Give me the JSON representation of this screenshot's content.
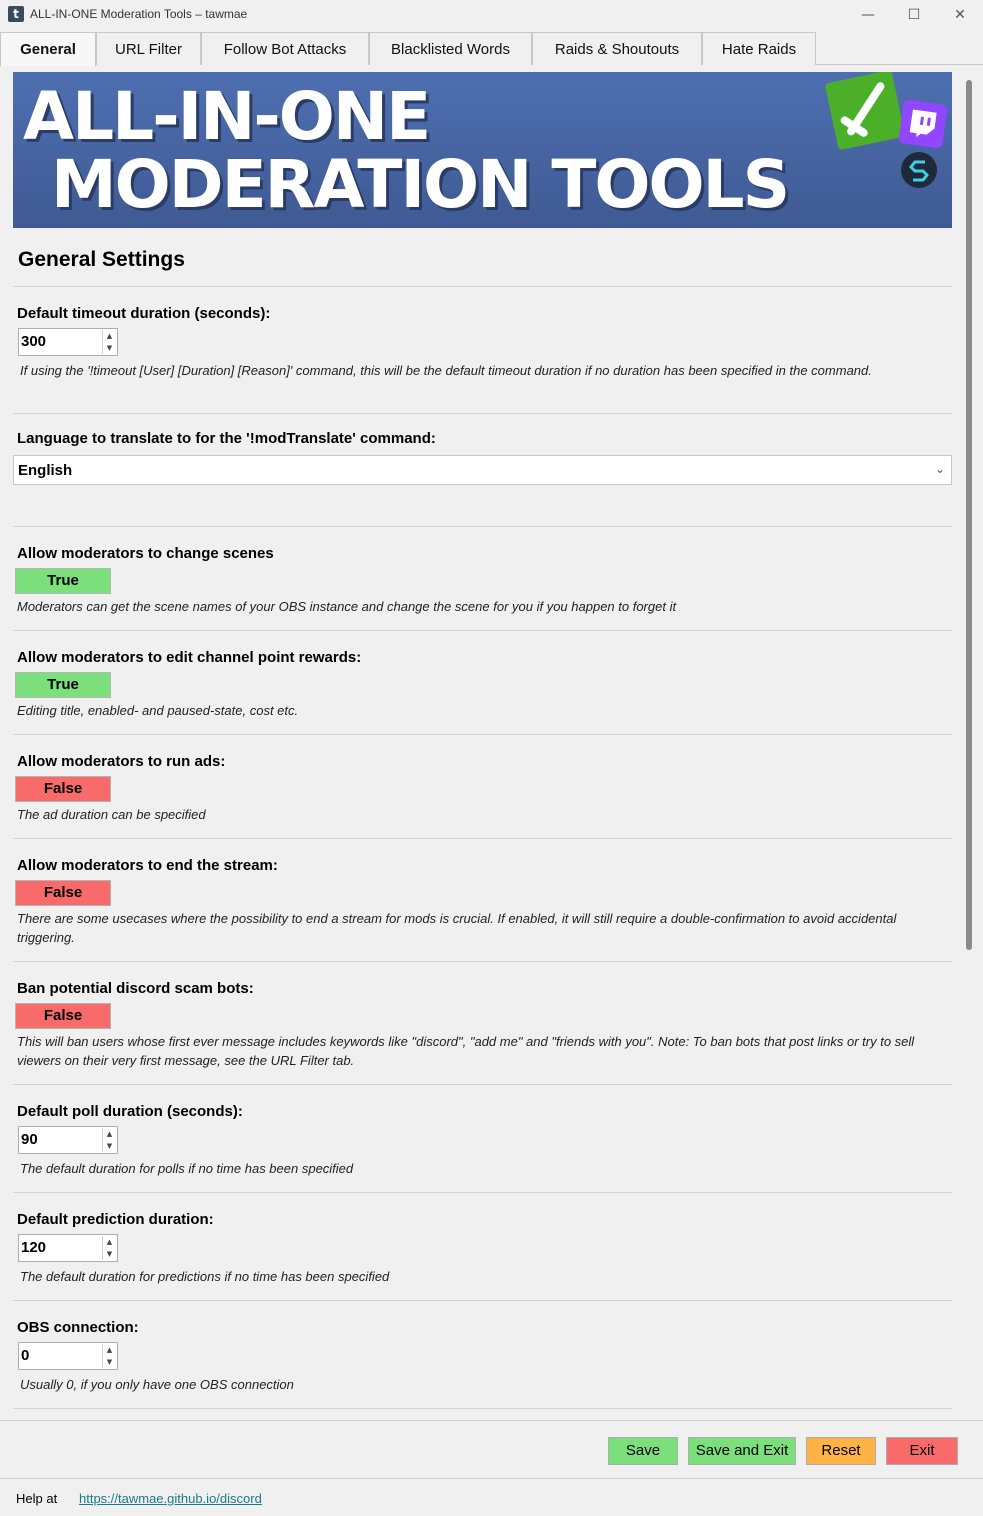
{
  "window": {
    "title": "ALL-IN-ONE Moderation Tools – tawmae",
    "app_icon_letter": "t",
    "minimize": "—",
    "maximize": "☐",
    "close": "✕"
  },
  "tabs": [
    {
      "label": "General",
      "active": true
    },
    {
      "label": "URL Filter"
    },
    {
      "label": "Follow Bot Attacks"
    },
    {
      "label": "Blacklisted Words"
    },
    {
      "label": "Raids & Shoutouts"
    },
    {
      "label": "Hate Raids"
    }
  ],
  "banner": {
    "line1": "ALL-IN-ONE",
    "line2": "MODERATION TOOLS"
  },
  "general": {
    "section_title": "General Settings",
    "timeout": {
      "label": "Default timeout duration (seconds):",
      "value": "300",
      "desc": "If using the '!timeout [User] [Duration] [Reason]' command, this will be the default timeout duration if no duration has been specified in the command."
    },
    "translate": {
      "label": "Language to translate to for the '!modTranslate' command:",
      "value": "English"
    },
    "scenes": {
      "label": "Allow moderators to change scenes",
      "value": "True",
      "desc": "Moderators can get the scene names of your OBS instance and change the scene for you if you happen to forget it"
    },
    "rewards": {
      "label": "Allow moderators to edit channel point rewards:",
      "value": "True",
      "desc": "Editing title, enabled- and paused-state, cost etc."
    },
    "ads": {
      "label": "Allow moderators to run ads:",
      "value": "False",
      "desc": "The ad duration can be specified"
    },
    "endstream": {
      "label": "Allow moderators to end the stream:",
      "value": "False",
      "desc": "There are some usecases where the possibility to end a stream for mods is crucial. If enabled, it will still require a double-confirmation to avoid accidental triggering."
    },
    "scambots": {
      "label": "Ban potential discord scam bots:",
      "value": "False",
      "desc": "This will ban users whose first ever message includes keywords like \"discord\", \"add me\" and \"friends with you\". Note: To ban bots that post links or try to sell viewers on their very first message, see the URL Filter tab."
    },
    "poll": {
      "label": "Default poll duration (seconds):",
      "value": "90",
      "desc": "The default duration for polls if no time has been specified"
    },
    "prediction": {
      "label": "Default prediction duration:",
      "value": "120",
      "desc": "The default duration for predictions if no time has been specified"
    },
    "obs": {
      "label": "OBS connection:",
      "value": "0",
      "desc": "Usually 0, if you only have one OBS connection"
    }
  },
  "footer": {
    "save": "Save",
    "save_exit": "Save and Exit",
    "reset": "Reset",
    "exit": "Exit",
    "help_label": "Help at",
    "help_link": "https://tawmae.github.io/discord"
  },
  "colors": {
    "true_bg": "#7be07b",
    "false_bg": "#f96b6b",
    "reset_bg": "#ffb347",
    "link": "#1a7a8a"
  }
}
